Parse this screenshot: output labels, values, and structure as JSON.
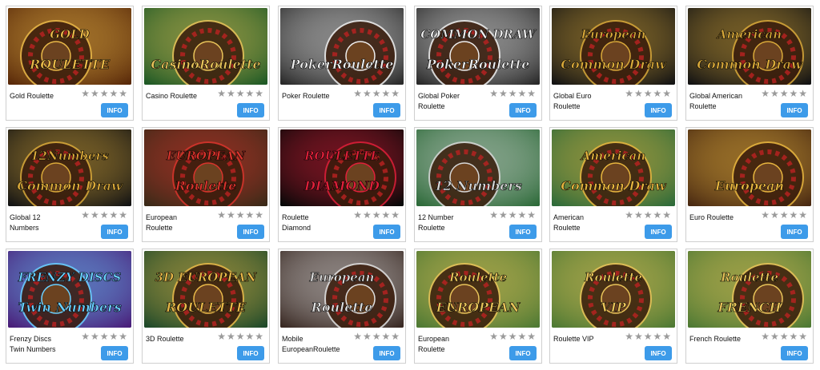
{
  "info_label": "INFO",
  "star_glyph": "★★★★★",
  "games": [
    {
      "name_line1": "Gold Roulette",
      "name_line2": "",
      "thumb_top": "GOLD",
      "thumb_bottom": "ROULETTE",
      "bg": "#5a2a0a",
      "accent": "#e9b949",
      "icon": "gold-roulette-thumbnail"
    },
    {
      "name_line1": "Casino Roulette",
      "name_line2": "",
      "thumb_top": "",
      "thumb_bottom": "CasinoRoulette",
      "bg": "#1f5a26",
      "accent": "#e9c45a",
      "icon": "casino-roulette-thumbnail"
    },
    {
      "name_line1": "Poker Roulette",
      "name_line2": "",
      "thumb_top": "",
      "thumb_bottom": "PokerRoulette",
      "bg": "#2a2a2a",
      "accent": "#eeeeee",
      "icon": "poker-roulette-thumbnail"
    },
    {
      "name_line1": "Global Poker",
      "name_line2": "Roulette",
      "thumb_top": "COMMON DRAW",
      "thumb_bottom": "PokerRoulette",
      "bg": "#2a2a2a",
      "accent": "#eeeeee",
      "icon": "global-poker-roulette-thumbnail"
    },
    {
      "name_line1": "Global Euro",
      "name_line2": "Roulette",
      "thumb_top": "European",
      "thumb_bottom": "Common Draw",
      "bg": "#141414",
      "accent": "#d9a93a",
      "icon": "global-euro-roulette-thumbnail"
    },
    {
      "name_line1": "Global American",
      "name_line2": "Roulette",
      "thumb_top": "American",
      "thumb_bottom": "Common Draw",
      "bg": "#141414",
      "accent": "#d9a93a",
      "icon": "global-american-roulette-thumbnail"
    },
    {
      "name_line1": "Global 12",
      "name_line2": "Numbers",
      "thumb_top": "12Numbers",
      "thumb_bottom": "Common Draw",
      "bg": "#141414",
      "accent": "#d9a93a",
      "icon": "global-12-numbers-thumbnail"
    },
    {
      "name_line1": "European",
      "name_line2": "Roulette",
      "thumb_top": "EUROPEAN",
      "thumb_bottom": "Roulette",
      "bg": "#3b2a18",
      "accent": "#d8342c",
      "icon": "european-roulette-thumbnail"
    },
    {
      "name_line1": "Roulette",
      "name_line2": "Diamond",
      "thumb_top": "ROULETTE",
      "thumb_bottom": "DIAMOND",
      "bg": "#080808",
      "accent": "#e0203a",
      "icon": "roulette-diamond-thumbnail"
    },
    {
      "name_line1": "12 Number",
      "name_line2": "Roulette",
      "thumb_top": "",
      "thumb_bottom": "12 Numbers",
      "bg": "#2e6b3a",
      "accent": "#d8d8d8",
      "icon": "12-number-roulette-thumbnail"
    },
    {
      "name_line1": "American",
      "name_line2": "Roulette",
      "thumb_top": "American",
      "thumb_bottom": "Common Draw",
      "bg": "#2e6b3a",
      "accent": "#e7b53f",
      "icon": "american-roulette-thumbnail"
    },
    {
      "name_line1": "Euro Roulette",
      "name_line2": "",
      "thumb_top": "",
      "thumb_bottom": "European",
      "bg": "#4a2a12",
      "accent": "#e7b53f",
      "icon": "euro-roulette-thumbnail"
    },
    {
      "name_line1": "Frenzy Discs",
      "name_line2": "Twin Numbers",
      "thumb_top": "FRENZY DISCS",
      "thumb_bottom": "Twin Numbers",
      "bg": "#4a1f7a",
      "accent": "#6ad0ff",
      "icon": "frenzy-discs-thumbnail"
    },
    {
      "name_line1": "3D Roulette",
      "name_line2": "",
      "thumb_top": "3D EUROPEAN",
      "thumb_bottom": "ROULETTE",
      "bg": "#1f4a2a",
      "accent": "#e9b949",
      "icon": "3d-roulette-thumbnail"
    },
    {
      "name_line1": "Mobile",
      "name_line2": "EuropeanRoulette",
      "thumb_top": "European",
      "thumb_bottom": "Roulette",
      "bg": "#3a2a24",
      "accent": "#e0e0e0",
      "icon": "mobile-european-roulette-thumbnail"
    },
    {
      "name_line1": "European",
      "name_line2": "Roulette",
      "thumb_top": "Roulette",
      "thumb_bottom": "EUROPEAN",
      "bg": "#4f7a34",
      "accent": "#e9c45a",
      "icon": "european-roulette-2-thumbnail"
    },
    {
      "name_line1": "Roulette VIP",
      "name_line2": "",
      "thumb_top": "Roulette",
      "thumb_bottom": "VIP",
      "bg": "#4f7a34",
      "accent": "#e9c45a",
      "icon": "roulette-vip-thumbnail"
    },
    {
      "name_line1": "French Roulette",
      "name_line2": "",
      "thumb_top": "Roulette",
      "thumb_bottom": "FRENCH",
      "bg": "#4f7a34",
      "accent": "#e9c45a",
      "icon": "french-roulette-thumbnail"
    }
  ]
}
